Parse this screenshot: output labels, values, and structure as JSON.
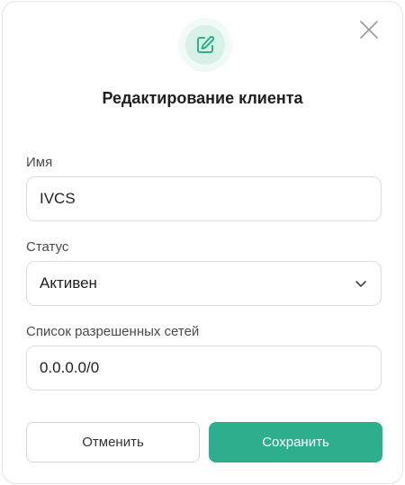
{
  "dialog": {
    "title": "Редактирование клиента",
    "accent_color": "#2daf8e",
    "header_icon": "edit-icon",
    "close_icon": "close-icon"
  },
  "form": {
    "name": {
      "label": "Имя",
      "value": "IVCS"
    },
    "status": {
      "label": "Статус",
      "selected": "Активен",
      "icon": "chevron-down-icon"
    },
    "networks": {
      "label": "Список разрешенных сетей",
      "value": "0.0.0.0/0"
    }
  },
  "actions": {
    "cancel_label": "Отменить",
    "save_label": "Сохранить"
  }
}
